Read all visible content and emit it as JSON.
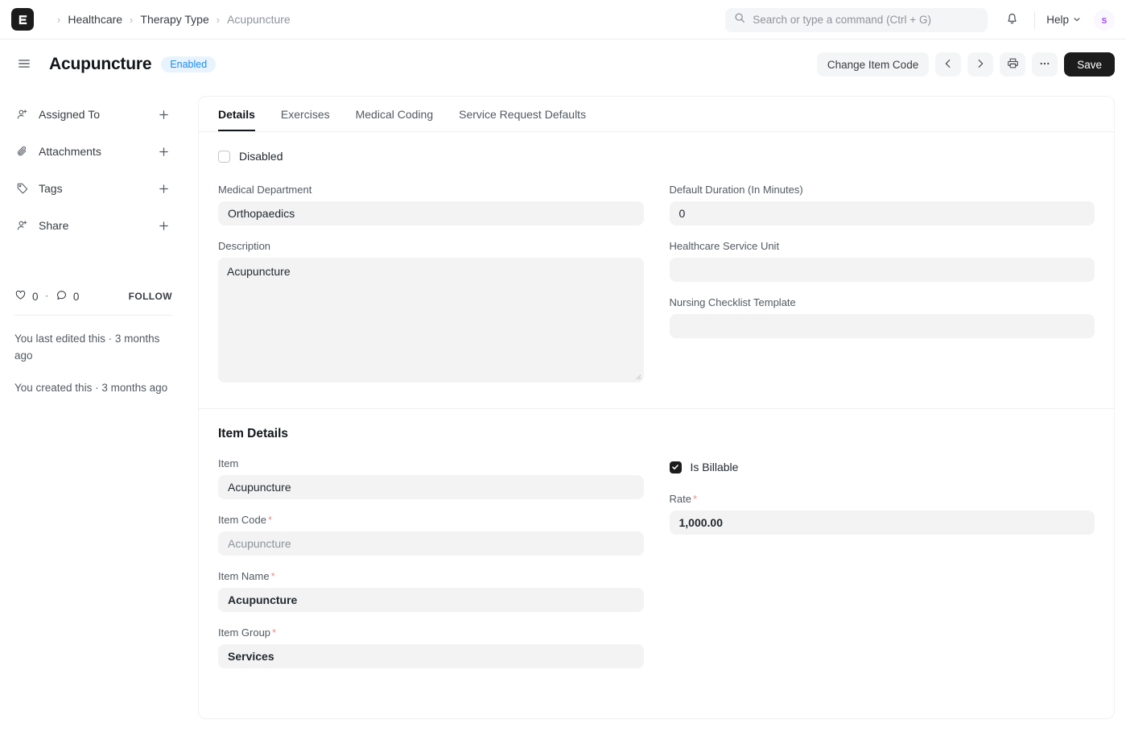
{
  "navbar": {
    "logo_icon": "erpnext-logo-icon",
    "breadcrumbs": [
      {
        "label": "Healthcare",
        "current": false
      },
      {
        "label": "Therapy Type",
        "current": false
      },
      {
        "label": "Acupuncture",
        "current": true
      }
    ],
    "separator": "›",
    "search": {
      "placeholder": "Search or type a command (Ctrl + G)",
      "value": "",
      "icon": "search-icon"
    },
    "notifications_icon": "bell-icon",
    "help_label": "Help",
    "help_caret_icon": "chevron-down-icon",
    "avatar_initial": "s"
  },
  "page_header": {
    "menu_icon": "hamburger-menu-icon",
    "title": "Acupuncture",
    "status_badge": {
      "label": "Enabled",
      "bg": "#e8f3fe",
      "color": "#1a8cf5"
    },
    "actions": {
      "change_item_code": "Change Item Code",
      "prev_icon": "chevron-left-icon",
      "next_icon": "chevron-right-icon",
      "print_icon": "printer-icon",
      "more_icon": "ellipsis-icon",
      "more_label": "···",
      "save": "Save"
    }
  },
  "sidebar": {
    "items": [
      {
        "label": "Assigned To",
        "icon": "assign-user-icon",
        "add_icon": "plus-icon"
      },
      {
        "label": "Attachments",
        "icon": "paperclip-icon",
        "add_icon": "plus-icon"
      },
      {
        "label": "Tags",
        "icon": "tag-icon",
        "add_icon": "plus-icon"
      },
      {
        "label": "Share",
        "icon": "share-user-icon",
        "add_icon": "plus-icon"
      }
    ],
    "stats": {
      "like_icon": "heart-icon",
      "like_count": "0",
      "dot": "·",
      "comment_icon": "comment-icon",
      "comment_count": "0",
      "follow_label": "FOLLOW"
    },
    "last_edited": "You last edited this · 3 months ago",
    "created": "You created this · 3 months ago"
  },
  "main": {
    "tabs": [
      {
        "label": "Details",
        "active": true
      },
      {
        "label": "Exercises",
        "active": false
      },
      {
        "label": "Medical Coding",
        "active": false
      },
      {
        "label": "Service Request Defaults",
        "active": false
      }
    ],
    "disabled_checkbox": {
      "label": "Disabled",
      "checked": false
    },
    "fields": {
      "medical_department": {
        "label": "Medical Department",
        "value": "Orthopaedics"
      },
      "description": {
        "label": "Description",
        "value": "Acupuncture"
      },
      "default_duration": {
        "label": "Default Duration (In Minutes)",
        "value": "0"
      },
      "healthcare_service_unit": {
        "label": "Healthcare Service Unit",
        "value": ""
      },
      "nursing_checklist_template": {
        "label": "Nursing Checklist Template",
        "value": ""
      }
    },
    "item_details": {
      "title": "Item Details",
      "item": {
        "label": "Item",
        "value": "Acupuncture",
        "required": false
      },
      "item_code": {
        "label": "Item Code",
        "value": "Acupuncture",
        "required": true
      },
      "item_name": {
        "label": "Item Name",
        "value": "Acupuncture",
        "required": true
      },
      "item_group": {
        "label": "Item Group",
        "value": "Services",
        "required": true
      },
      "is_billable": {
        "label": "Is Billable",
        "checked": true
      },
      "rate": {
        "label": "Rate",
        "value": "1,000.00",
        "required": true
      }
    },
    "required_marker": "*"
  }
}
